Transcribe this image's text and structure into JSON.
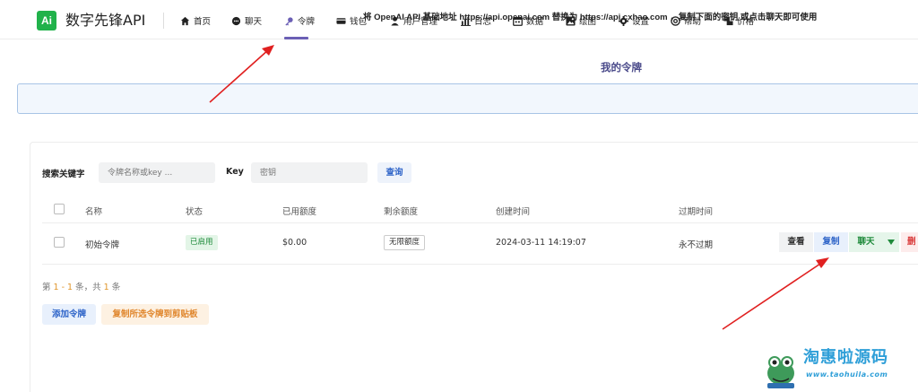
{
  "app": {
    "logo_text": "Ai",
    "brand": "数字先锋API"
  },
  "nav": {
    "items": [
      {
        "label": "首页",
        "icon": "home-icon"
      },
      {
        "label": "聊天",
        "icon": "chat-icon"
      },
      {
        "label": "令牌",
        "icon": "key-icon",
        "active": true
      },
      {
        "label": "钱包",
        "icon": "wallet-icon"
      },
      {
        "label": "用户管理",
        "icon": "user-icon"
      },
      {
        "label": "日志",
        "icon": "chart-icon"
      },
      {
        "label": "数据",
        "icon": "calendar-icon"
      },
      {
        "label": "绘图",
        "icon": "image-icon"
      },
      {
        "label": "设置",
        "icon": "gear-icon"
      },
      {
        "label": "帮助",
        "icon": "at-icon"
      },
      {
        "label": "价格",
        "icon": "price-icon"
      }
    ]
  },
  "page": {
    "title": "我的令牌",
    "banner": "将 OpenAI API 基础地址 https://api.openai.com 替换为 https://api.cxhao.com ，复制下面的密钥 或点击聊天即可使用"
  },
  "search": {
    "keyword_label": "搜索关键字",
    "keyword_placeholder": "令牌名称或key ...",
    "key_label": "Key",
    "key_placeholder": "密钥",
    "query_label": "查询"
  },
  "table": {
    "columns": [
      "名称",
      "状态",
      "已用额度",
      "剩余额度",
      "创建时间",
      "过期时间"
    ],
    "rows": [
      {
        "name": "初始令牌",
        "status": "已启用",
        "used": "$0.00",
        "remaining": "无限额度",
        "created": "2024-03-11 14:19:07",
        "expires": "永不过期",
        "actions": {
          "view": "查看",
          "copy": "复制",
          "chat": "聊天",
          "delete": "删"
        }
      }
    ]
  },
  "pagination": {
    "prefix": "第 ",
    "range": "1 - 1",
    "mid": " 条，共 ",
    "total": "1",
    "suffix": " 条"
  },
  "footer_buttons": {
    "add": "添加令牌",
    "copy_selected": "复制所选令牌到剪贴板"
  },
  "watermark": {
    "text": "淘惠啦源码",
    "url": "www.taohuila.com"
  },
  "colors": {
    "accent": "#6b5fb5",
    "logo_green": "#21b24b",
    "arrow_red": "#e02020",
    "banner_bg": "#f2f7fd",
    "banner_border": "#a8c4e6"
  }
}
